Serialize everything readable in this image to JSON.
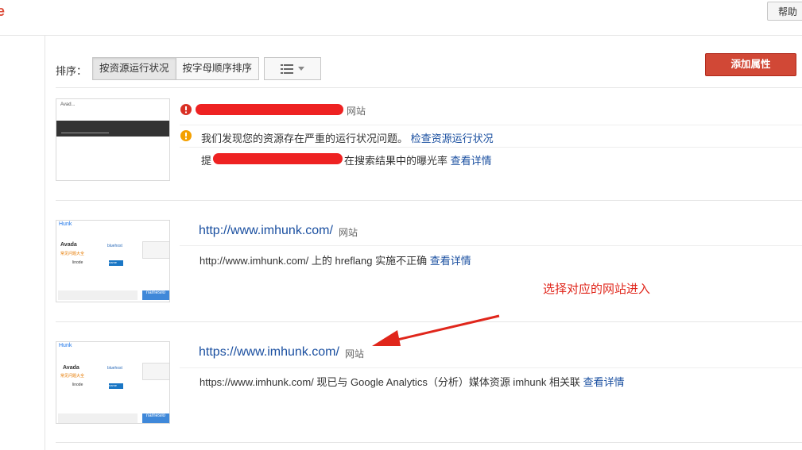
{
  "header": {
    "brand_fragment": "e",
    "help_label": "帮助"
  },
  "toolbar": {
    "sort_label": "排序：",
    "sort_options": [
      "按资源运行状况",
      "按字母顺序排序"
    ],
    "add_property_label": "添加属性"
  },
  "properties": [
    {
      "url": "",
      "type": "网站",
      "thumb_text": "Avad...",
      "messages": {
        "alert": "我们发现您的资源存在严重的运行状况问题。",
        "alert_link": "检查资源运行状况",
        "info_prefix": "提",
        "info_suffix": "在搜索结果中的曝光率",
        "info_link": "查看详情"
      }
    },
    {
      "url": "http://www.imhunk.com/",
      "type": "网站",
      "message": "http://www.imhunk.com/ 上的 hreflang 实施不正确",
      "message_link": "查看详情"
    },
    {
      "url": "https://www.imhunk.com/",
      "type": "网站",
      "message": "https://www.imhunk.com/ 现已与 Google Analytics（分析）媒体资源 imhunk 相关联",
      "message_link": "查看详情"
    }
  ],
  "thumb_site": {
    "logo": "Hunk",
    "items": [
      "Avada",
      "bluehost",
      "linode",
      "name",
      "namesilo"
    ],
    "faq": "常见问题大全"
  },
  "annotation": "选择对应的网站进入",
  "colors": {
    "accent_red": "#d14836",
    "link_blue": "#1a4fa0",
    "annotation_red": "#e0261b"
  }
}
